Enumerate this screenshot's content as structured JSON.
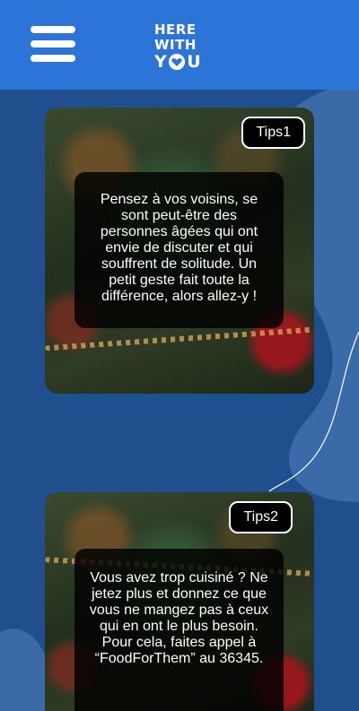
{
  "header": {
    "menu_icon": "hamburger-menu-icon",
    "logo": {
      "line1": "HERE",
      "line2": "WITH",
      "line3_left": "Y",
      "line3_right": "U",
      "heart_icon": "heart-icon"
    }
  },
  "tips": [
    {
      "label": "Tips1",
      "text": "Pensez à vos voisins, se sont peut-être des personnes âgées qui ont envie de discuter et qui souffrent de solitude. Un petit geste fait toute la différence, alors allez-y !"
    },
    {
      "label": "Tips2",
      "text": "Vous avez trop cuisiné ? Ne jetez plus et donnez ce que vous ne mangez pas à ceux qui en ont le plus besoin. Pour cela, faites appel à “FoodForThem” au 36345."
    }
  ],
  "colors": {
    "header": "#2c74d8",
    "background": "#1f4f8c",
    "blob": "#3a6ba8"
  }
}
